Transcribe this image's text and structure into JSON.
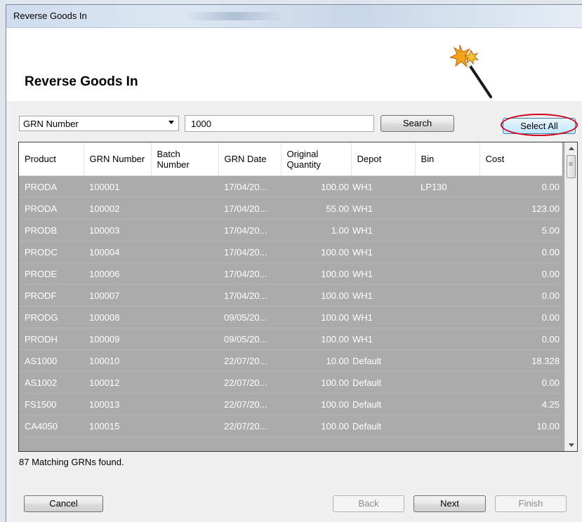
{
  "window": {
    "title": "Reverse Goods In"
  },
  "header": {
    "heading": "Reverse Goods In",
    "icon": "magic-wand-icon"
  },
  "search": {
    "field_selected": "GRN Number",
    "query": "1000",
    "search_label": "Search",
    "select_all_label": "Select All"
  },
  "grid": {
    "columns": [
      "Product",
      "GRN Number",
      "Batch Number",
      "GRN Date",
      "Original Quantity",
      "Depot",
      "Bin",
      "Cost"
    ],
    "rows": [
      [
        "PRODA",
        "100001",
        "",
        "17/04/20...",
        "100.00",
        "WH1",
        "LP130",
        "0.00"
      ],
      [
        "PRODA",
        "100002",
        "",
        "17/04/20...",
        "55.00",
        "WH1",
        "",
        "123.00"
      ],
      [
        "PRODB",
        "100003",
        "",
        "17/04/20...",
        "1.00",
        "WH1",
        "",
        "5.00"
      ],
      [
        "PRODC",
        "100004",
        "",
        "17/04/20...",
        "100.00",
        "WH1",
        "",
        "0.00"
      ],
      [
        "PRODE",
        "100006",
        "",
        "17/04/20...",
        "100.00",
        "WH1",
        "",
        "0.00"
      ],
      [
        "PRODF",
        "100007",
        "",
        "17/04/20...",
        "100.00",
        "WH1",
        "",
        "0.00"
      ],
      [
        "PRODG",
        "100008",
        "",
        "09/05/20...",
        "100.00",
        "WH1",
        "",
        "0.00"
      ],
      [
        "PRODH",
        "100009",
        "",
        "09/05/20...",
        "100.00",
        "WH1",
        "",
        "0.00"
      ],
      [
        "AS1000",
        "100010",
        "",
        "22/07/20...",
        "10.00",
        "Default",
        "",
        "18.328"
      ],
      [
        "AS1002",
        "100012",
        "",
        "22/07/20...",
        "100.00",
        "Default",
        "",
        "0.00"
      ],
      [
        "FS1500",
        "100013",
        "",
        "22/07/20...",
        "100.00",
        "Default",
        "",
        "4.25"
      ],
      [
        "CA4050",
        "100015",
        "",
        "22/07/20...",
        "100.00",
        "Default",
        "",
        "10.00"
      ]
    ]
  },
  "status": {
    "text": "87 Matching GRNs found."
  },
  "buttons": {
    "cancel": "Cancel",
    "back": "Back",
    "next": "Next",
    "finish": "Finish"
  },
  "colors": {
    "selected_row_bg": "#ababab",
    "highlight_circle": "#d2001a"
  }
}
